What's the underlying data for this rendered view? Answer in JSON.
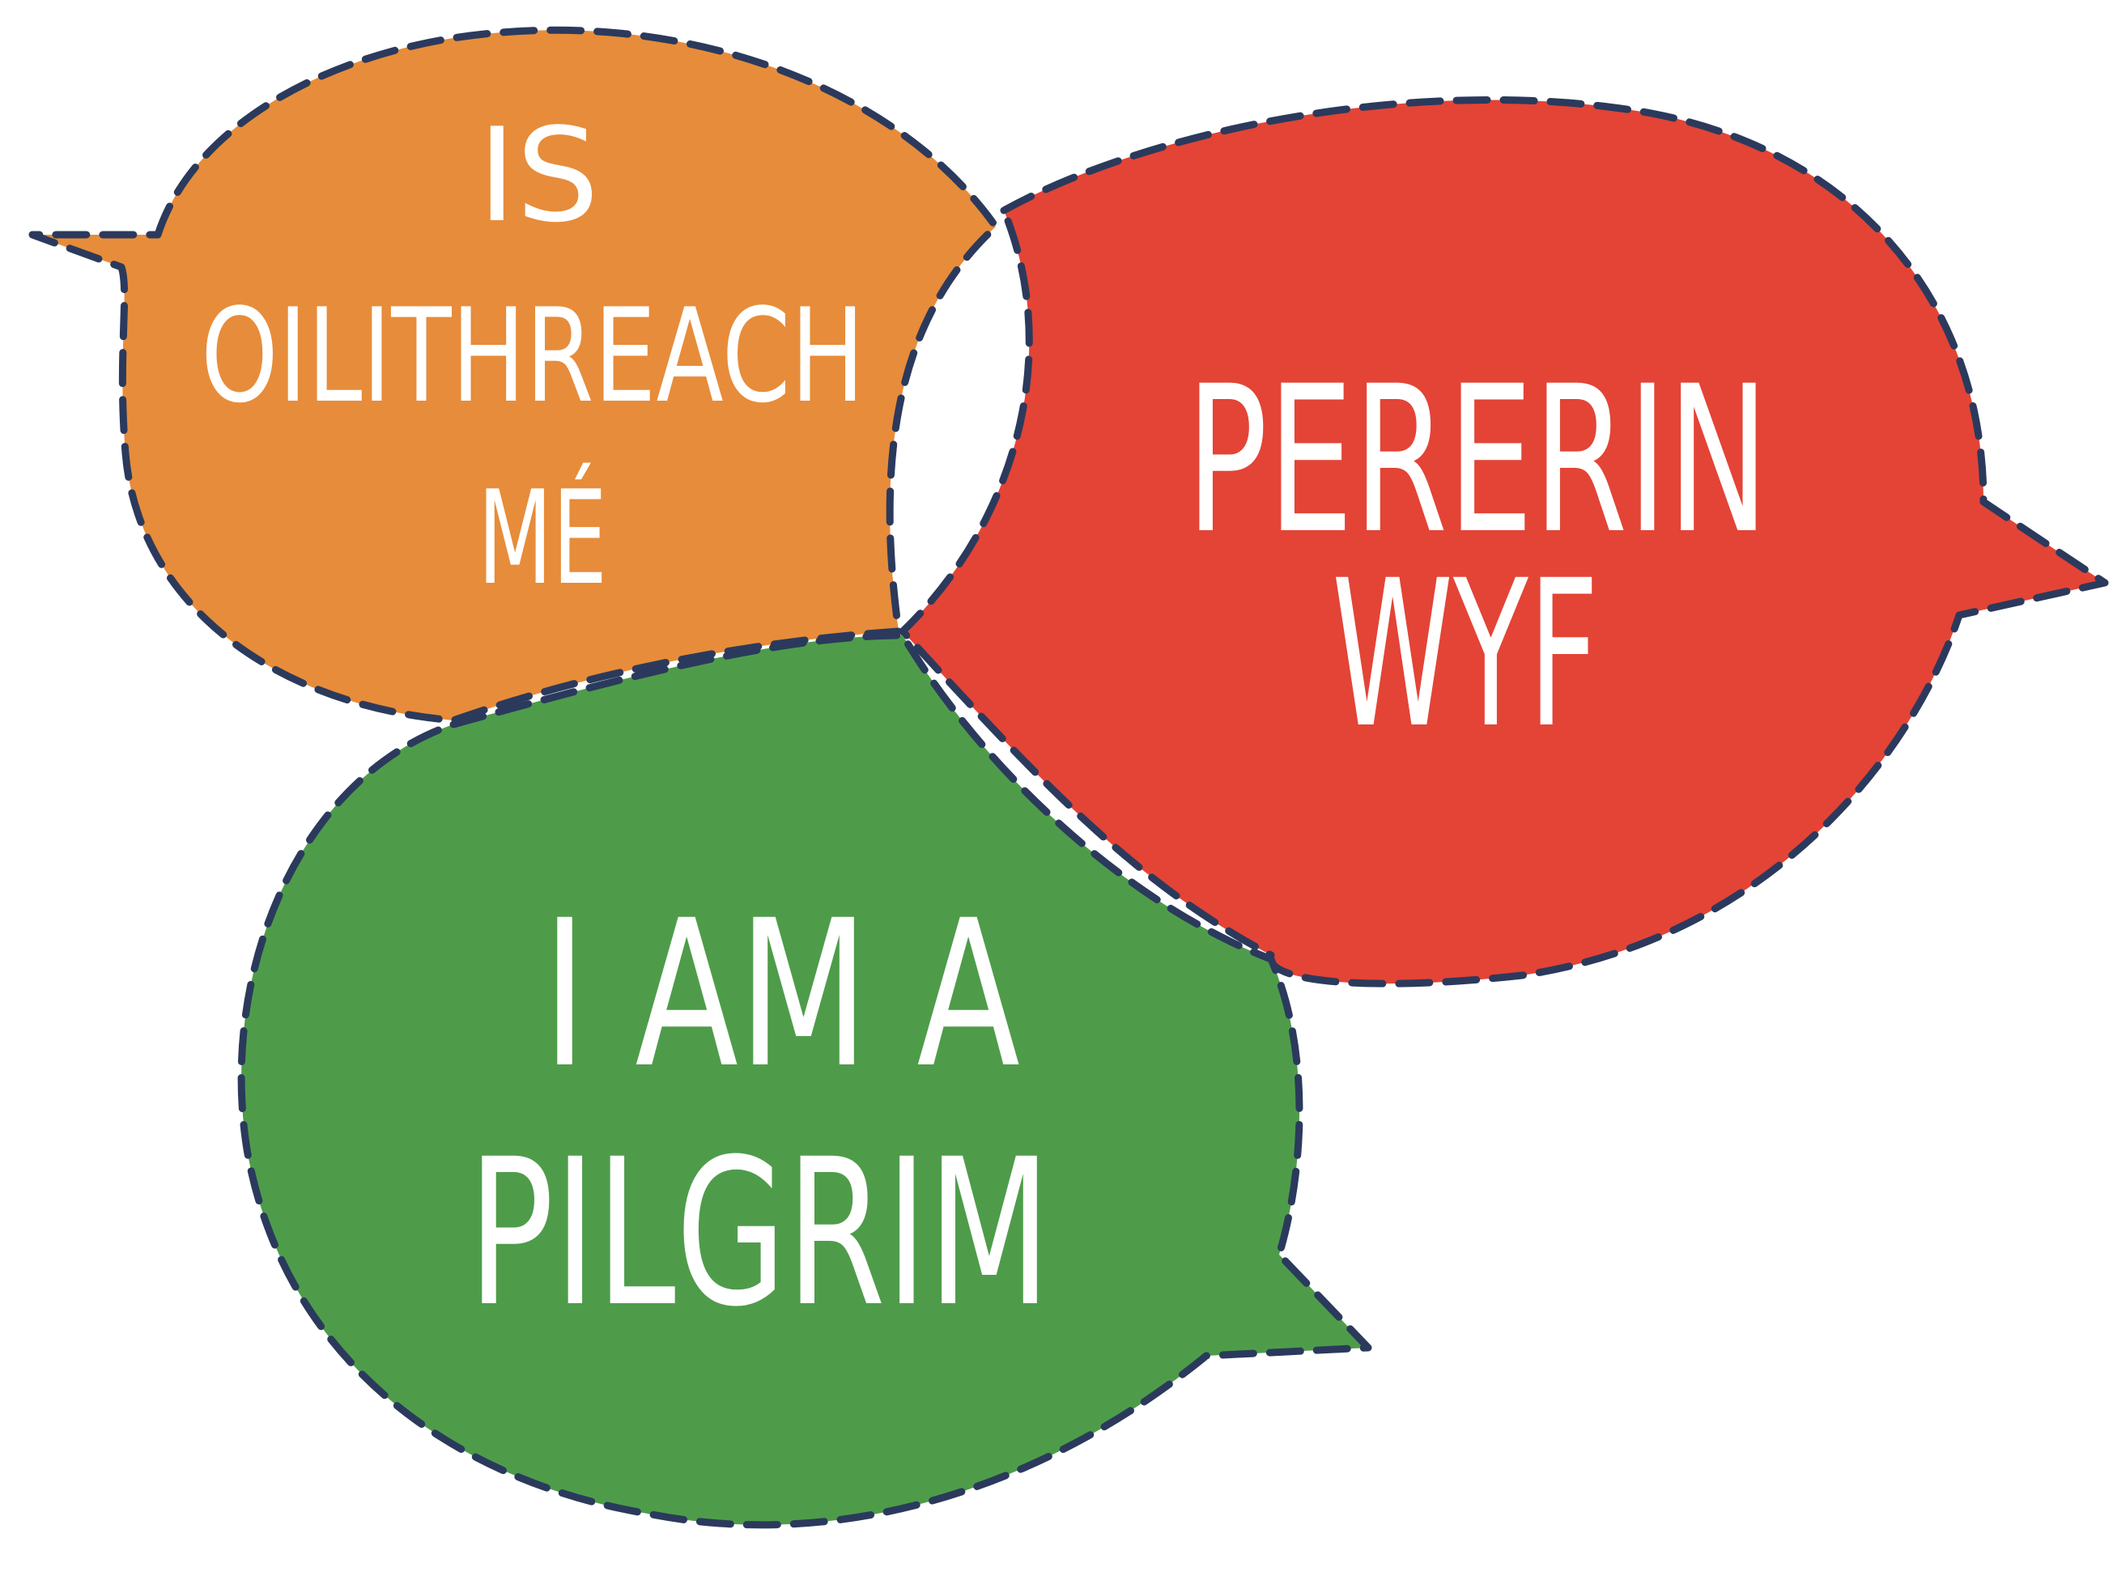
{
  "colors": {
    "background": "#ffffff",
    "outline": "#2b3a5c",
    "text": "#ffffff"
  },
  "bubbles": [
    {
      "id": "irish",
      "color": "#e78c3a",
      "lines": [
        "IS",
        "OILITHREACH",
        "MÉ"
      ]
    },
    {
      "id": "welsh",
      "color": "#e34436",
      "lines": [
        "PERERIN",
        "WYF"
      ]
    },
    {
      "id": "english",
      "color": "#4e9c4a",
      "lines": [
        "I AM A",
        "PILGRIM"
      ]
    }
  ]
}
